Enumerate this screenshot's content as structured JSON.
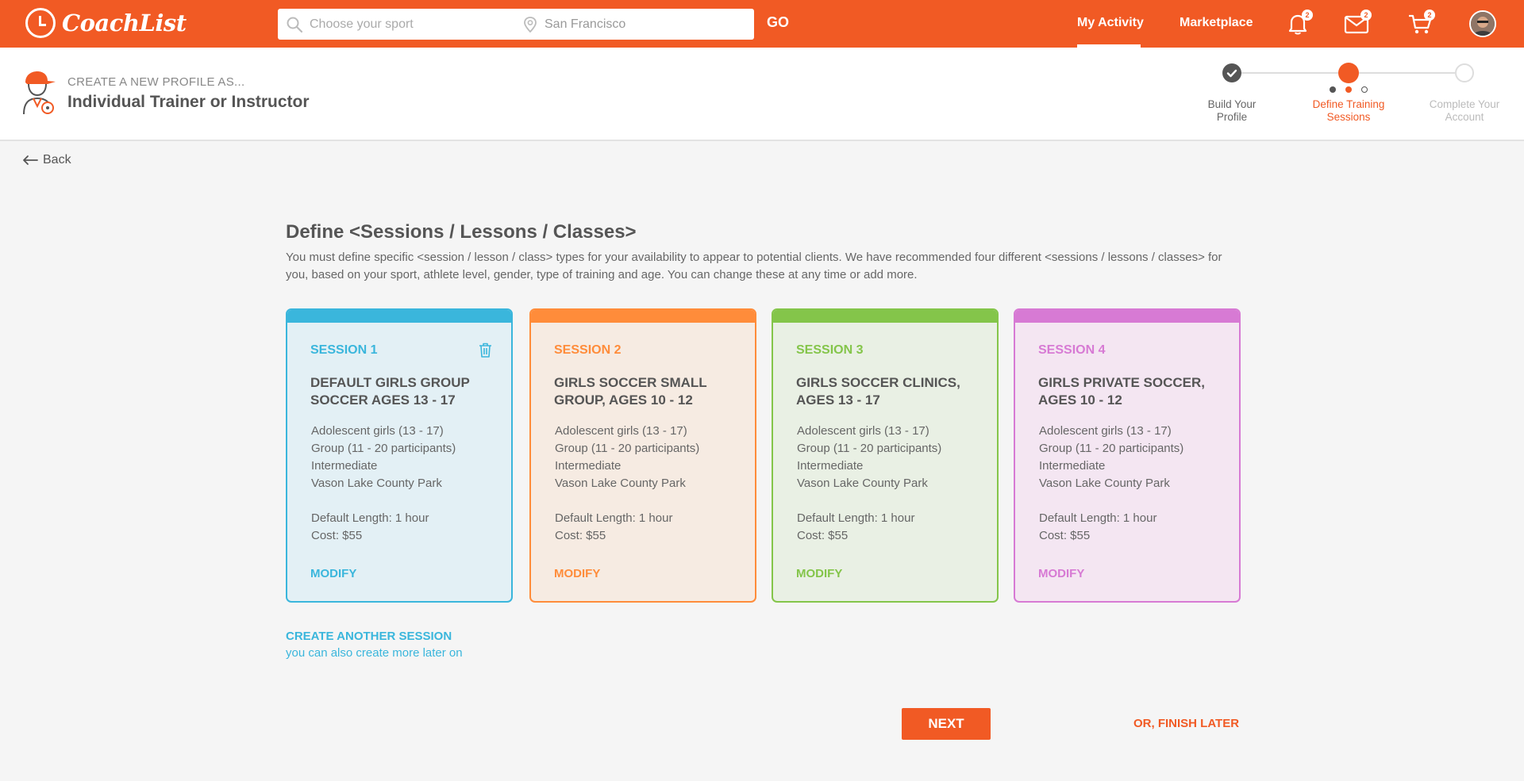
{
  "brand": {
    "name": "CoachList"
  },
  "search": {
    "sport_placeholder": "Choose your sport",
    "location_placeholder": "San Francisco",
    "go_label": "GO"
  },
  "nav": {
    "my_activity": "My Activity",
    "marketplace": "Marketplace",
    "notifications_count": "2",
    "messages_count": "2",
    "cart_count": "2"
  },
  "profile": {
    "create_label": "CREATE A NEW PROFILE AS...",
    "type": "Individual Trainer or Instructor"
  },
  "stepper": {
    "steps": [
      {
        "line1": "Build Your",
        "line2": "Profile",
        "state": "done"
      },
      {
        "line1": "Define Training",
        "line2": "Sessions",
        "state": "current"
      },
      {
        "line1": "Complete Your",
        "line2": "Account",
        "state": "future"
      }
    ]
  },
  "back_label": "Back",
  "page": {
    "title": "Define <Sessions / Lessons / Classes>",
    "description": "You must define specific <session / lesson / class> types for your availability to appear to potential clients. We have recommended four different <sessions / lessons / classes> for you, based on your sport, athlete level, gender, type of training and age. You can change these at any time or add more."
  },
  "sessions": [
    {
      "label": "SESSION 1",
      "title": "DEFAULT GIRLS GROUP SOCCER AGES 13 - 17",
      "details": [
        "Adolescent girls (13 - 17)",
        "Group (11 - 20 participants)",
        "Intermediate",
        "Vason Lake County Park"
      ],
      "length": "Default Length: 1 hour",
      "cost": "Cost: $55",
      "modify": "MODIFY",
      "color": "#3ab6dc",
      "bg": "#e3f0f5"
    },
    {
      "label": "SESSION 2",
      "title": "GIRLS SOCCER SMALL GROUP, AGES 10 - 12",
      "details": [
        "Adolescent girls (13 - 17)",
        "Group (11 - 20 participants)",
        "Intermediate",
        "Vason Lake County Park"
      ],
      "length": "Default Length: 1 hour",
      "cost": "Cost: $55",
      "modify": "MODIFY",
      "color": "#ff8c3a",
      "bg": "#f6ebe2"
    },
    {
      "label": "SESSION 3",
      "title": "GIRLS SOCCER CLINICS, AGES 13 - 17",
      "details": [
        "Adolescent girls (13 - 17)",
        "Group (11 - 20 participants)",
        "Intermediate",
        "Vason Lake County Park"
      ],
      "length": "Default Length: 1 hour",
      "cost": "Cost: $55",
      "modify": "MODIFY",
      "color": "#84c54a",
      "bg": "#e9f0e4"
    },
    {
      "label": "SESSION 4",
      "title": "GIRLS PRIVATE SOCCER, AGES 10 - 12",
      "details": [
        "Adolescent girls (13 - 17)",
        "Group (11 - 20 participants)",
        "Intermediate",
        "Vason Lake County Park"
      ],
      "length": "Default Length: 1 hour",
      "cost": "Cost: $55",
      "modify": "MODIFY",
      "color": "#d77ad4",
      "bg": "#f4e6f2"
    }
  ],
  "create_another": {
    "label": "CREATE ANOTHER SESSION",
    "hint": "you can also create more later on"
  },
  "actions": {
    "next": "NEXT",
    "finish_later": "OR, FINISH LATER"
  },
  "colors": {
    "brand": "#f15a24",
    "link": "#3ab6dc"
  },
  "icons": [
    "search-icon",
    "location-pin-icon",
    "bell-icon",
    "mail-icon",
    "cart-icon",
    "back-arrow-icon",
    "trash-icon",
    "checkmark-icon"
  ]
}
